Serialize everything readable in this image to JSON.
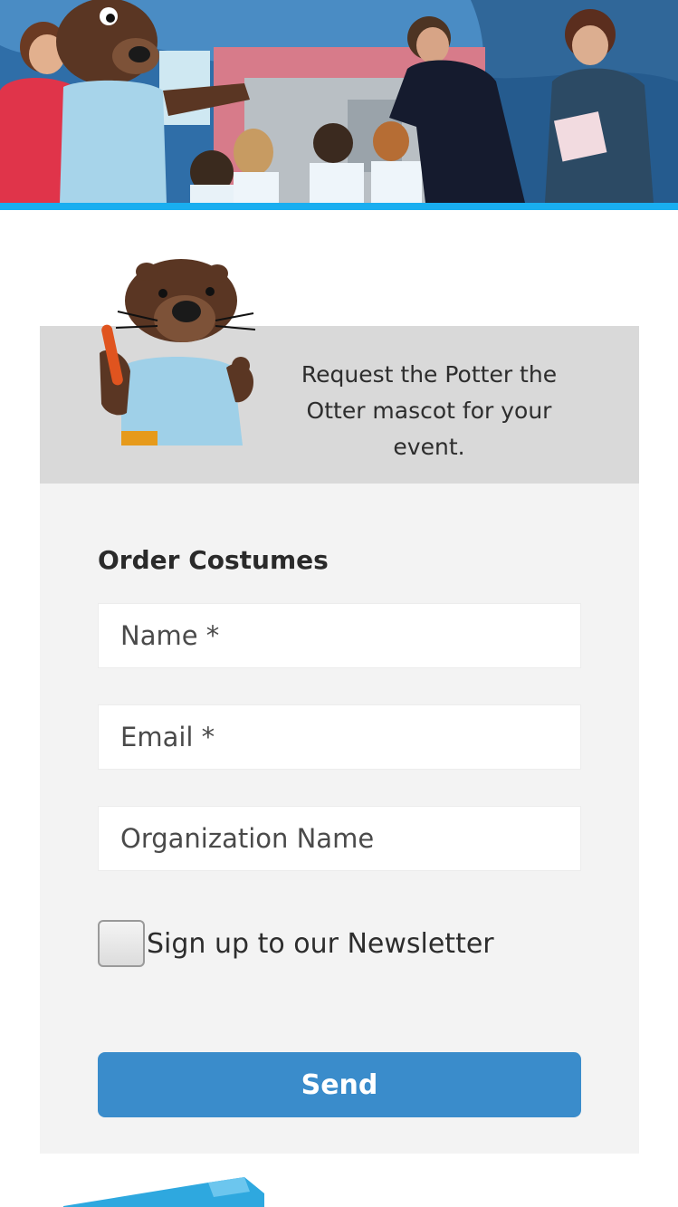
{
  "promo": {
    "text": "Request the Potter the Otter mascot for your event."
  },
  "form": {
    "title": "Order Costumes",
    "name_placeholder": "Name *",
    "email_placeholder": "Email *",
    "org_placeholder": "Organization Name",
    "newsletter_label": "Sign up to our Newsletter",
    "newsletter_checked": false,
    "send_label": "Send"
  },
  "colors": {
    "hero_stripe": "#19aef0",
    "promo_bg": "#d9d9d9",
    "form_bg": "#f3f3f3",
    "send_button": "#3a8ccb"
  }
}
